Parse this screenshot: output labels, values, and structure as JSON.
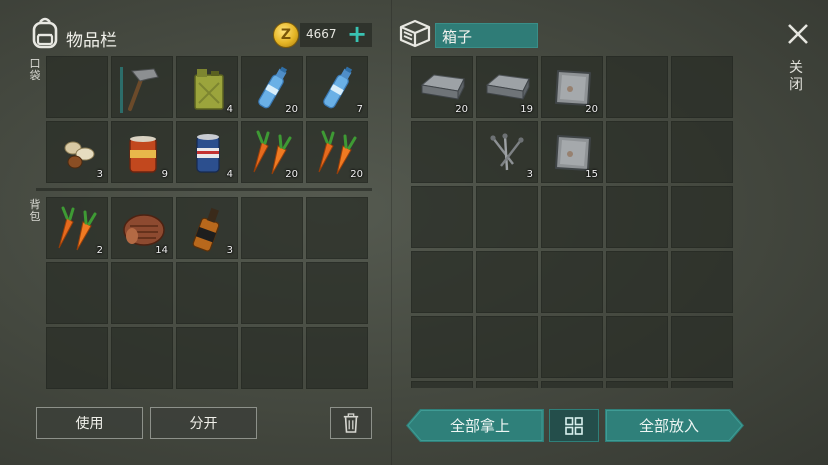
{
  "inventory": {
    "title": "物品栏",
    "icon": "backpack-icon",
    "money": "4667",
    "coin_letter": "Z",
    "plus": "+",
    "pocket_label": [
      "口",
      "袋"
    ],
    "backpack_label": [
      "背",
      "包"
    ],
    "pockets": [
      {
        "item": "",
        "count": ""
      },
      {
        "item": "hammer",
        "count": ""
      },
      {
        "item": "fuel-canister",
        "count": "4"
      },
      {
        "item": "water-bottle",
        "count": "20"
      },
      {
        "item": "water-bottle",
        "count": "7"
      },
      {
        "item": "nuts",
        "count": "3"
      },
      {
        "item": "canned-food",
        "count": "9"
      },
      {
        "item": "soda-can",
        "count": "4"
      },
      {
        "item": "carrots",
        "count": "20"
      },
      {
        "item": "carrots",
        "count": "20"
      }
    ],
    "backpack": [
      {
        "item": "carrots",
        "count": "2"
      },
      {
        "item": "steak",
        "count": "14"
      },
      {
        "item": "whiskey",
        "count": "3"
      },
      {
        "item": "",
        "count": ""
      },
      {
        "item": "",
        "count": ""
      },
      {
        "item": "",
        "count": ""
      },
      {
        "item": "",
        "count": ""
      },
      {
        "item": "",
        "count": ""
      },
      {
        "item": "",
        "count": ""
      },
      {
        "item": "",
        "count": ""
      },
      {
        "item": "",
        "count": ""
      },
      {
        "item": "",
        "count": ""
      },
      {
        "item": "",
        "count": ""
      },
      {
        "item": "",
        "count": ""
      },
      {
        "item": "",
        "count": ""
      }
    ],
    "buttons": {
      "use": "使用",
      "split": "分开",
      "trash_icon": "trash-icon"
    }
  },
  "container": {
    "title": "箱子",
    "icon": "box-icon",
    "slots": [
      {
        "item": "iron-ingot",
        "count": "20"
      },
      {
        "item": "iron-ingot",
        "count": "19"
      },
      {
        "item": "metal-plate",
        "count": "20"
      },
      {
        "item": "",
        "count": ""
      },
      {
        "item": "",
        "count": ""
      },
      {
        "item": "",
        "count": ""
      },
      {
        "item": "nails",
        "count": "3"
      },
      {
        "item": "metal-plate",
        "count": "15"
      },
      {
        "item": "",
        "count": ""
      },
      {
        "item": "",
        "count": ""
      }
    ],
    "empty_rows": 4,
    "buttons": {
      "take_all": "全部拿上",
      "put_all": "全部放入",
      "sort_icon": "grid-sort-icon"
    }
  },
  "close": {
    "label": [
      "关",
      "闭"
    ],
    "icon": "close-icon"
  },
  "colors": {
    "accent": "#2f807a",
    "coin": "#e5b525",
    "plus": "#39c3b3"
  }
}
